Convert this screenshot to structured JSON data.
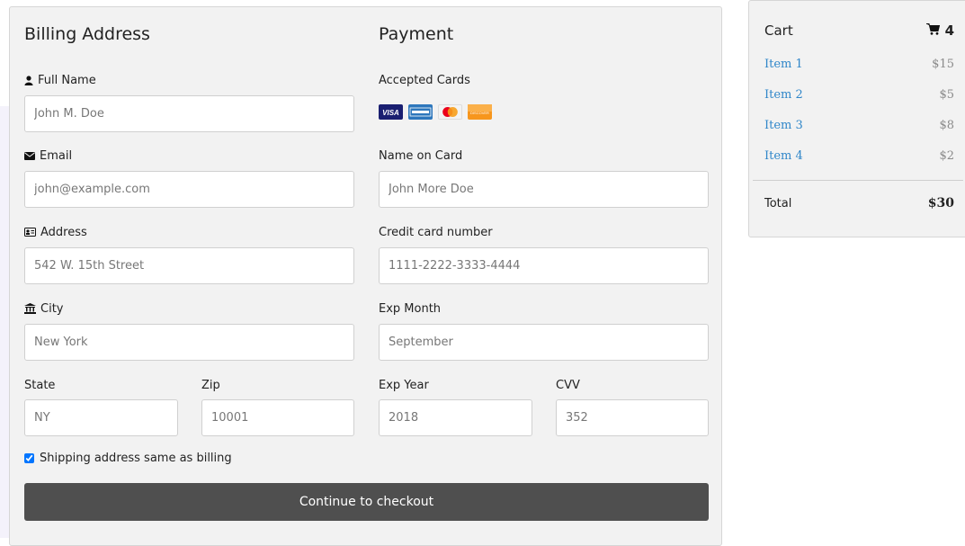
{
  "billing": {
    "title": "Billing Address",
    "full_name": {
      "label": "Full Name",
      "placeholder": "John M. Doe",
      "icon": "user-icon"
    },
    "email": {
      "label": "Email",
      "placeholder": "john@example.com",
      "icon": "envelope-icon"
    },
    "address": {
      "label": "Address",
      "placeholder": "542 W. 15th Street",
      "icon": "address-card-icon"
    },
    "city": {
      "label": "City",
      "placeholder": "New York",
      "icon": "institution-icon"
    },
    "state": {
      "label": "State",
      "placeholder": "NY"
    },
    "zip": {
      "label": "Zip",
      "placeholder": "10001"
    }
  },
  "payment": {
    "title": "Payment",
    "accepted_cards_label": "Accepted Cards",
    "cards": [
      "visa-icon",
      "amex-icon",
      "mastercard-icon",
      "discover-icon"
    ],
    "name_on_card": {
      "label": "Name on Card",
      "placeholder": "John More Doe"
    },
    "card_number": {
      "label": "Credit card number",
      "placeholder": "1111-2222-3333-4444"
    },
    "exp_month": {
      "label": "Exp Month",
      "placeholder": "September"
    },
    "exp_year": {
      "label": "Exp Year",
      "placeholder": "2018"
    },
    "cvv": {
      "label": "CVV",
      "placeholder": "352"
    }
  },
  "shipping_same_label": "Shipping address same as billing",
  "shipping_same_checked": true,
  "checkout_button": "Continue to checkout",
  "cart": {
    "title": "Cart",
    "count": "4",
    "icon": "shopping-cart-icon",
    "items": [
      {
        "name": "Item 1",
        "price": "$15"
      },
      {
        "name": "Item 2",
        "price": "$5"
      },
      {
        "name": "Item 3",
        "price": "$8"
      },
      {
        "name": "Item 4",
        "price": "$2"
      }
    ],
    "total_label": "Total",
    "total_value": "$30"
  },
  "colors": {
    "panel_bg": "#f2f2f2",
    "button_bg": "#4f4f4f",
    "link": "#2f86c9"
  }
}
